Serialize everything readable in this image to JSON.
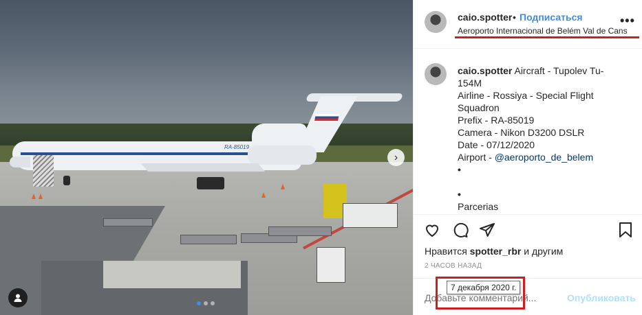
{
  "post": {
    "username": "caio.spotter",
    "separator": "•",
    "follow_label": "Подписаться",
    "location": "Aeroporto Internacional de Belém Val de Cans",
    "more_label": "•••",
    "plane_registration": "RA-85019",
    "carousel_next": "›",
    "carousel_dots": 3,
    "carousel_active": 0
  },
  "caption": {
    "username": "caio.spotter",
    "lines": [
      "Aircraft - Tupolev Tu-154M",
      "Airline - Rossiya - Special Flight Squadron",
      "Prefix - RA-85019",
      "Camera - Nikon D3200 DSLR",
      "Date - 07/12/2020"
    ],
    "airport_label": "Airport - ",
    "airport_mention": "@aeroporto_de_belem",
    "bullet1": "•",
    "bullet2": "•",
    "partners": "Parcerias"
  },
  "engagement": {
    "likes_prefix": "Нравится",
    "likes_user": "spotter_rbr",
    "likes_suffix": "и другим",
    "time_ago": "2 ЧАСОВ НАЗАД",
    "date_tooltip": "7 декабря 2020 г."
  },
  "comment": {
    "placeholder": "Добавьте комментарий...",
    "publish_label": "Опубликовать"
  },
  "colors": {
    "accent": "#3f8ede",
    "highlight": "#cc1f1f",
    "link": "#00376b"
  }
}
